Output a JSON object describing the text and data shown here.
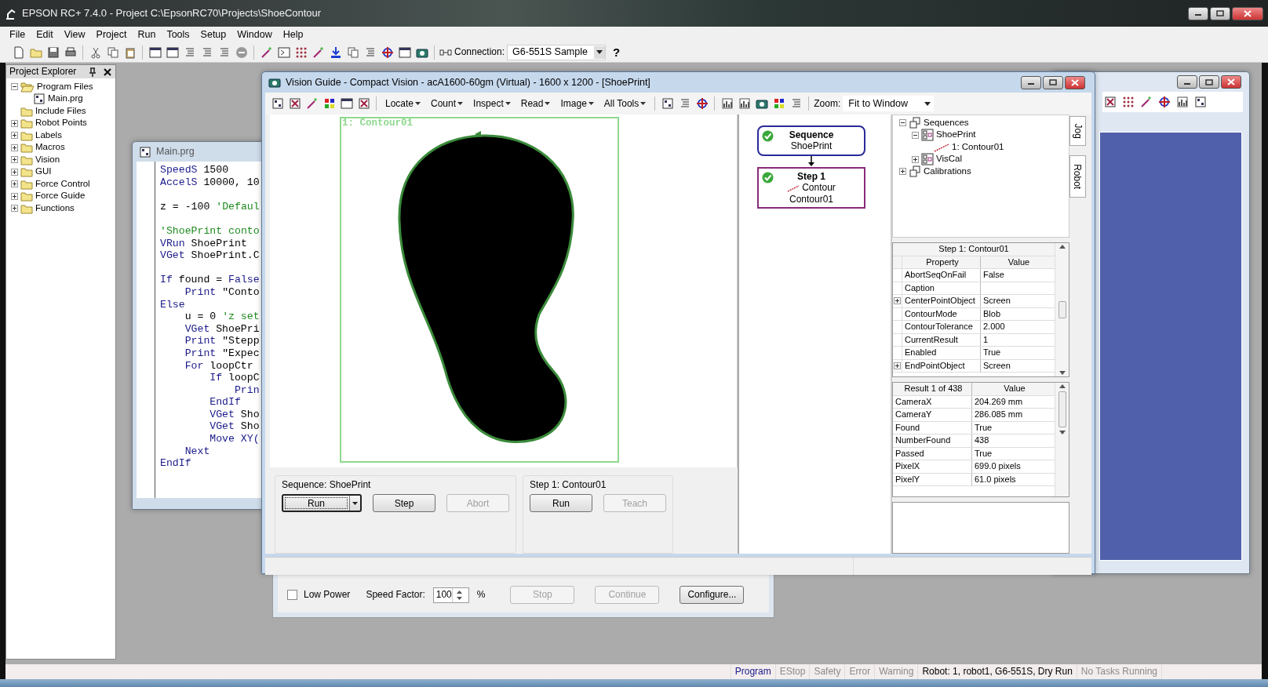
{
  "window": {
    "title": "EPSON RC+ 7.4.0 - Project C:\\EpsonRC70\\Projects\\ShoeContour"
  },
  "menu": [
    "File",
    "Edit",
    "View",
    "Project",
    "Run",
    "Tools",
    "Setup",
    "Window",
    "Help"
  ],
  "toolbar": {
    "connection_label": "Connection:",
    "connection_value": "G6-551S Sample",
    "help": "?"
  },
  "project_explorer": {
    "title": "Project Explorer",
    "items": [
      {
        "label": "Program Files",
        "kind": "folder",
        "has_toggle": true,
        "expanded": true,
        "children": [
          {
            "label": "Main.prg",
            "kind": "file",
            "has_toggle": false
          }
        ]
      },
      {
        "label": "Include Files",
        "kind": "folder",
        "has_toggle": false
      },
      {
        "label": "Robot Points",
        "kind": "folder",
        "has_toggle": true,
        "expanded": false
      },
      {
        "label": "Labels",
        "kind": "folder",
        "has_toggle": true,
        "expanded": false
      },
      {
        "label": "Macros",
        "kind": "folder",
        "has_toggle": true,
        "expanded": false
      },
      {
        "label": "Vision",
        "kind": "folder",
        "has_toggle": true,
        "expanded": false
      },
      {
        "label": "GUI",
        "kind": "folder",
        "has_toggle": true,
        "expanded": false
      },
      {
        "label": "Force Control",
        "kind": "folder",
        "has_toggle": true,
        "expanded": false
      },
      {
        "label": "Force Guide",
        "kind": "folder",
        "has_toggle": true,
        "expanded": false
      },
      {
        "label": "Functions",
        "kind": "folder",
        "has_toggle": true,
        "expanded": false
      }
    ]
  },
  "editor": {
    "title": "Main.prg",
    "lines": [
      {
        "kind": "code",
        "parts": [
          {
            "kind": "keyword",
            "text": "SpeedS"
          },
          {
            "kind": "plain",
            "text": " 1500"
          }
        ]
      },
      {
        "kind": "code",
        "parts": [
          {
            "kind": "keyword",
            "text": "AccelS"
          },
          {
            "kind": "plain",
            "text": " 10000, 10"
          }
        ]
      },
      {
        "kind": "blank"
      },
      {
        "kind": "code",
        "parts": [
          {
            "kind": "plain",
            "text": "z = -100 "
          },
          {
            "kind": "comment",
            "text": "'Defaul"
          }
        ]
      },
      {
        "kind": "blank"
      },
      {
        "kind": "code",
        "parts": [
          {
            "kind": "comment",
            "text": "'ShoePrint conto"
          }
        ]
      },
      {
        "kind": "code",
        "parts": [
          {
            "kind": "keyword",
            "text": "VRun"
          },
          {
            "kind": "plain",
            "text": " ShoePrint"
          }
        ]
      },
      {
        "kind": "code",
        "parts": [
          {
            "kind": "keyword",
            "text": "VGet"
          },
          {
            "kind": "plain",
            "text": " ShoePrint.C"
          }
        ]
      },
      {
        "kind": "blank"
      },
      {
        "kind": "code",
        "parts": [
          {
            "kind": "keyword",
            "text": "If"
          },
          {
            "kind": "plain",
            "text": " found = "
          },
          {
            "kind": "keyword",
            "text": "False"
          }
        ],
        "children": [
          {
            "kind": "code",
            "parts": [
              {
                "kind": "keyword",
                "text": "Print"
              },
              {
                "kind": "plain",
                "text": " \"Conto"
              }
            ]
          }
        ]
      },
      {
        "kind": "code",
        "parts": [
          {
            "kind": "keyword",
            "text": "Else"
          }
        ],
        "children": [
          {
            "kind": "code",
            "parts": [
              {
                "kind": "plain",
                "text": "u = 0 "
              },
              {
                "kind": "comment",
                "text": "'z set"
              }
            ]
          },
          {
            "kind": "code",
            "parts": [
              {
                "kind": "keyword",
                "text": "VGet"
              },
              {
                "kind": "plain",
                "text": " ShoePri"
              }
            ]
          },
          {
            "kind": "code",
            "parts": [
              {
                "kind": "keyword",
                "text": "Print"
              },
              {
                "kind": "plain",
                "text": " \"Stepp"
              }
            ]
          },
          {
            "kind": "code",
            "parts": [
              {
                "kind": "keyword",
                "text": "Print"
              },
              {
                "kind": "plain",
                "text": " \"Expec"
              }
            ]
          },
          {
            "kind": "code",
            "parts": [
              {
                "kind": "keyword",
                "text": "For"
              },
              {
                "kind": "plain",
                "text": " loopCtr"
              }
            ],
            "children": [
              {
                "kind": "code",
                "parts": [
                  {
                    "kind": "keyword",
                    "text": "If"
                  },
                  {
                    "kind": "plain",
                    "text": " loopC"
                  }
                ],
                "children": [
                  {
                    "kind": "code",
                    "parts": [
                      {
                        "kind": "keyword",
                        "text": "Prin"
                      }
                    ]
                  }
                ]
              },
              {
                "kind": "code",
                "parts": [
                  {
                    "kind": "keyword",
                    "text": "EndIf"
                  }
                ]
              },
              {
                "kind": "code",
                "parts": [
                  {
                    "kind": "keyword",
                    "text": "VGet"
                  },
                  {
                    "kind": "plain",
                    "text": " Sho"
                  }
                ]
              },
              {
                "kind": "code",
                "parts": [
                  {
                    "kind": "keyword",
                    "text": "VGet"
                  },
                  {
                    "kind": "plain",
                    "text": " Sho"
                  }
                ]
              },
              {
                "kind": "code",
                "parts": [
                  {
                    "kind": "keyword",
                    "text": "Move XY("
                  }
                ]
              }
            ]
          },
          {
            "kind": "code",
            "parts": [
              {
                "kind": "keyword",
                "text": "Next"
              }
            ]
          }
        ]
      },
      {
        "kind": "code",
        "parts": [
          {
            "kind": "keyword",
            "text": "EndIf"
          }
        ]
      }
    ]
  },
  "vision_guide": {
    "title": "Vision Guide - Compact Vision - acA1600-60gm (Virtual) - 1600 x 1200 - [ShoePrint]",
    "menus": [
      "Locate",
      "Count",
      "Inspect",
      "Read",
      "Image",
      "All Tools"
    ],
    "zoom_label": "Zoom:",
    "zoom_value": "Fit to Window",
    "image": {
      "kind": "picture",
      "overlay_label": "1: Contour01"
    },
    "flow": [
      {
        "kind": "sequence",
        "title": "Sequence",
        "lines": [
          "ShoePrint"
        ],
        "passed": true
      },
      {
        "kind": "step",
        "title": "Step 1",
        "lines": [
          "Contour",
          "Contour01"
        ],
        "passed": true
      }
    ],
    "tree": [
      {
        "label": "Sequences",
        "kind": "group",
        "has_toggle": true,
        "expanded": true,
        "children": [
          {
            "label": "ShoePrint",
            "kind": "sequence",
            "has_toggle": true,
            "expanded": true,
            "children": [
              {
                "label": "1: Contour01",
                "kind": "contour",
                "has_toggle": false
              }
            ]
          },
          {
            "label": "VisCal",
            "kind": "sequence",
            "has_toggle": true,
            "expanded": false
          }
        ]
      },
      {
        "label": "Calibrations",
        "kind": "group",
        "has_toggle": true,
        "expanded": false
      }
    ],
    "side_tabs": [
      "Jog",
      "Robot"
    ],
    "properties": {
      "title": "Step 1: Contour01",
      "columns": [
        "Property",
        "Value"
      ],
      "rows": [
        {
          "name": "AbortSeqOnFail",
          "value": "False",
          "expandable": false
        },
        {
          "name": "Caption",
          "expandable": false
        },
        {
          "name": "CenterPointObject",
          "value": "Screen",
          "expandable": true
        },
        {
          "name": "ContourMode",
          "value": "Blob",
          "expandable": false
        },
        {
          "name": "ContourTolerance",
          "value": "2.000",
          "expandable": false
        },
        {
          "name": "CurrentResult",
          "value": "1",
          "expandable": false
        },
        {
          "name": "Enabled",
          "value": "True",
          "expandable": false
        },
        {
          "name": "EndPointObject",
          "value": "Screen",
          "expandable": true
        }
      ]
    },
    "results": {
      "columns": [
        "Result 1 of 438",
        "Value"
      ],
      "rows": [
        {
          "name": "CameraX",
          "value": "204.269 mm"
        },
        {
          "name": "CameraY",
          "value": "286.085 mm"
        },
        {
          "name": "Found",
          "value": "True"
        },
        {
          "name": "NumberFound",
          "value": "438"
        },
        {
          "name": "Passed",
          "value": "True"
        },
        {
          "name": "PixelX",
          "value": "699.0 pixels"
        },
        {
          "name": "PixelY",
          "value": "61.0 pixels"
        }
      ]
    },
    "groups": [
      {
        "title": "Sequence: ShoePrint",
        "buttons": [
          {
            "label": "Run",
            "kind": "split",
            "disabled": false,
            "focused": true
          },
          {
            "label": "Step",
            "kind": "plain",
            "disabled": false,
            "focused": false
          },
          {
            "label": "Abort",
            "kind": "plain",
            "disabled": true,
            "focused": false
          }
        ]
      },
      {
        "title": "Step 1: Contour01",
        "buttons": [
          {
            "label": "Run",
            "kind": "plain",
            "disabled": false,
            "focused": false
          },
          {
            "label": "Teach",
            "kind": "plain",
            "disabled": true,
            "focused": false
          }
        ]
      }
    ]
  },
  "robot_panel": {
    "low_power": {
      "label": "Low Power",
      "checked": false
    },
    "speed_label": "Speed Factor:",
    "speed_value": "100",
    "speed_unit": "%",
    "buttons": [
      {
        "label": "Stop",
        "disabled": true
      },
      {
        "label": "Continue",
        "disabled": true
      },
      {
        "label": "Configure...",
        "disabled": false
      }
    ]
  },
  "status_bar": [
    {
      "label": "Program",
      "kind": "indicator",
      "on": true
    },
    {
      "label": "EStop",
      "kind": "indicator",
      "on": false
    },
    {
      "label": "Safety",
      "kind": "indicator",
      "on": false
    },
    {
      "label": "Error",
      "kind": "indicator",
      "on": false
    },
    {
      "label": "Warning",
      "kind": "indicator",
      "on": false
    },
    {
      "label": "Robot: 1, robot1, G6-551S, Dry Run",
      "kind": "info"
    },
    {
      "label": "No Tasks Running",
      "kind": "indicator",
      "on": false
    }
  ]
}
